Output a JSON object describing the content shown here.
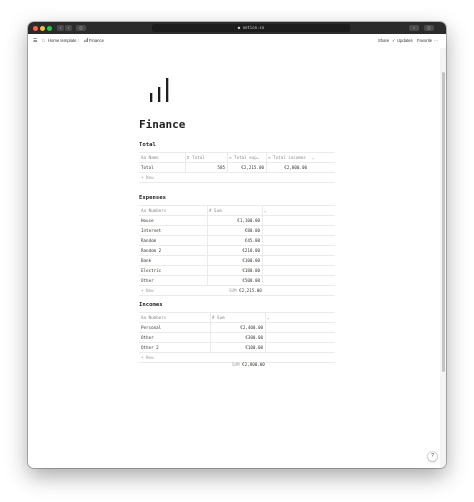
{
  "browser": {
    "url": "notion.so",
    "colors": {
      "close": "#ff5f57",
      "minimize": "#febc2e",
      "maximize": "#28c840"
    }
  },
  "topbar": {
    "breadcrumb_home": "Home template",
    "breadcrumb_sep": "/",
    "breadcrumb_page": "Finance",
    "share": "Share",
    "updates": "Updates",
    "favorite": "Favorite",
    "more": "···"
  },
  "page": {
    "icon": "bar-chart-icon",
    "title": "Finance"
  },
  "total": {
    "heading": "Total",
    "columns": [
      "Aa Name",
      "Σ Total",
      "≈ Total exp…",
      "≈ Total incomes"
    ],
    "row": {
      "name": "Total",
      "total": "585",
      "expenses": "€2,215.00",
      "incomes": "€2,800.00"
    },
    "new": "+ New"
  },
  "expenses": {
    "heading": "Expenses",
    "columns": [
      "Aa Numbers",
      "# Sum"
    ],
    "rows": [
      {
        "name": "House",
        "sum": "€1,100.00"
      },
      {
        "name": "Internet",
        "sum": "€80.00"
      },
      {
        "name": "Random",
        "sum": "€45.00"
      },
      {
        "name": "Random 2",
        "sum": "€210.00"
      },
      {
        "name": "Bank",
        "sum": "€100.00"
      },
      {
        "name": "Electric",
        "sum": "€180.00"
      },
      {
        "name": "Other",
        "sum": "€500.00"
      }
    ],
    "new": "+ New",
    "sum_label": "SUM",
    "sum_value": "€2,215.00"
  },
  "incomes": {
    "heading": "Incomes",
    "columns": [
      "Aa Numbers",
      "# Sum"
    ],
    "rows": [
      {
        "name": "Personal",
        "sum": "€2,400.00"
      },
      {
        "name": "Other",
        "sum": "€300.00"
      },
      {
        "name": "Other 2",
        "sum": "€100.00"
      }
    ],
    "new": "+ New",
    "sum_label": "SUM",
    "sum_value": "€2,800.00"
  },
  "help": "?"
}
